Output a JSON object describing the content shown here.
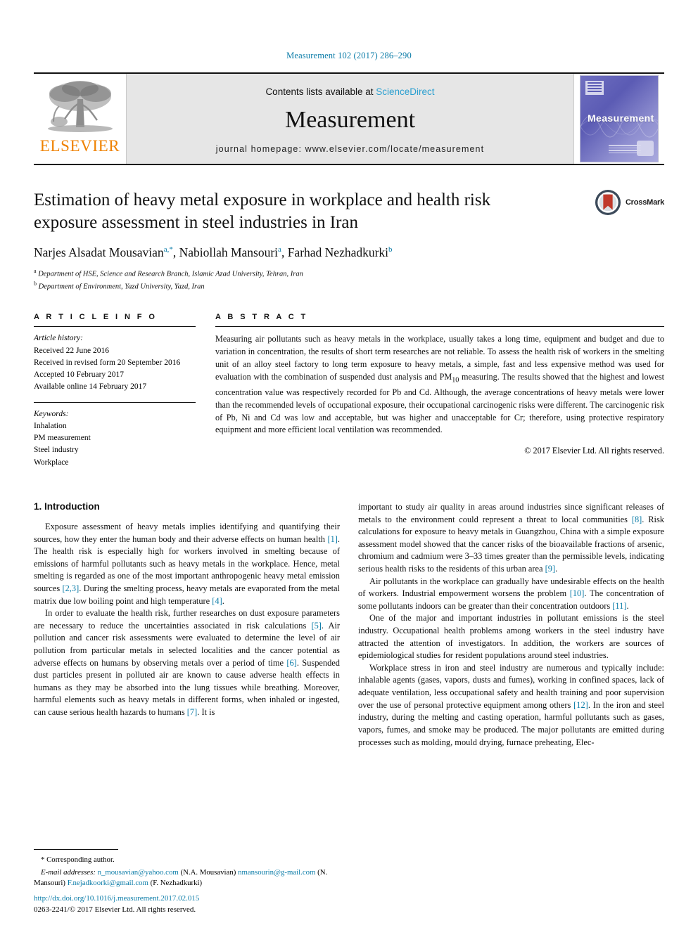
{
  "running_head": "Measurement 102 (2017) 286–290",
  "masthead": {
    "publisher_wordmark": "ELSEVIER",
    "contents_prefix": "Contents lists available at ",
    "contents_link": "ScienceDirect",
    "journal_name": "Measurement",
    "homepage": "journal homepage: www.elsevier.com/locate/measurement",
    "cover_title": "Measurement"
  },
  "article": {
    "title": "Estimation of heavy metal exposure in workplace and health risk exposure assessment in steel industries in Iran",
    "authors": [
      {
        "name": "Narjes Alsadat Mousavian",
        "marks": "a,*"
      },
      {
        "name": "Nabiollah Mansouri",
        "marks": "a"
      },
      {
        "name": "Farhad Nezhadkurki",
        "marks": "b"
      }
    ],
    "affiliations": [
      {
        "mark": "a",
        "text": "Department of HSE, Science and Research Branch, Islamic Azad University, Tehran, Iran"
      },
      {
        "mark": "b",
        "text": "Department of Environment, Yazd University, Yazd, Iran"
      }
    ],
    "crossmark_label": "CrossMark"
  },
  "article_info": {
    "heading": "A R T I C L E   I N F O",
    "history_label": "Article history:",
    "history": [
      "Received 22 June 2016",
      "Received in revised form 20 September 2016",
      "Accepted 10 February 2017",
      "Available online 14 February 2017"
    ],
    "keywords_label": "Keywords:",
    "keywords": [
      "Inhalation",
      "PM measurement",
      "Steel industry",
      "Workplace"
    ]
  },
  "abstract": {
    "heading": "A B S T R A C T",
    "text": "Measuring air pollutants such as heavy metals in the workplace, usually takes a long time, equipment and budget and due to variation in concentration, the results of short term researches are not reliable. To assess the health risk of workers in the smelting unit of an alloy steel factory to long term exposure to heavy metals, a simple, fast and less expensive method was used for evaluation with the combination of suspended dust analysis and PM10 measuring. The results showed that the highest and lowest concentration value was respectively recorded for Pb and Cd. Although, the average concentrations of heavy metals were lower than the recommended levels of occupational exposure, their occupational carcinogenic risks were different. The carcinogenic risk of Pb, Ni and Cd was low and acceptable, but was higher and unacceptable for Cr; therefore, using protective respiratory equipment and more efficient local ventilation was recommended.",
    "copyright": "© 2017 Elsevier Ltd. All rights reserved."
  },
  "body": {
    "section_heading": "1. Introduction",
    "left_paragraphs": [
      "Exposure assessment of heavy metals implies identifying and quantifying their sources, how they enter the human body and their adverse effects on human health [1]. The health risk is especially high for workers involved in smelting because of emissions of harmful pollutants such as heavy metals in the workplace. Hence, metal smelting is regarded as one of the most important anthropogenic heavy metal emission sources [2,3]. During the smelting process, heavy metals are evaporated from the metal matrix due low boiling point and high temperature [4].",
      "In order to evaluate the health risk, further researches on dust exposure parameters are necessary to reduce the uncertainties associated in risk calculations [5]. Air pollution and cancer risk assessments were evaluated to determine the level of air pollution from particular metals in selected localities and the cancer potential as adverse effects on humans by observing metals over a period of time [6]. Suspended dust particles present in polluted air are known to cause adverse health effects in humans as they may be absorbed into the lung tissues while breathing. Moreover, harmful elements such as heavy metals in different forms, when inhaled or ingested, can cause serious health hazards to humans [7]. It is"
    ],
    "right_paragraphs": [
      "important to study air quality in areas around industries since significant releases of metals to the environment could represent a threat to local communities [8]. Risk calculations for exposure to heavy metals in Guangzhou, China with a simple exposure assessment model showed that the cancer risks of the bioavailable fractions of arsenic, chromium and cadmium were 3–33 times greater than the permissible levels, indicating serious health risks to the residents of this urban area [9].",
      "Air pollutants in the workplace can gradually have undesirable effects on the health of workers. Industrial empowerment worsens the problem [10]. The concentration of some pollutants indoors can be greater than their concentration outdoors [11].",
      "One of the major and important industries in pollutant emissions is the steel industry. Occupational health problems among workers in the steel industry have attracted the attention of investigators. In addition, the workers are sources of epidemiological studies for resident populations around steel industries.",
      "Workplace stress in iron and steel industry are numerous and typically include: inhalable agents (gases, vapors, dusts and fumes), working in confined spaces, lack of adequate ventilation, less occupational safety and health training and poor supervision over the use of personal protective equipment among others [12]. In the iron and steel industry, during the melting and casting operation, harmful pollutants such as gases, vapors, fumes, and smoke may be produced. The major pollutants are emitted during processes such as molding, mould drying, furnace preheating, Elec-"
    ]
  },
  "footnote": {
    "corresponding": "* Corresponding author.",
    "emails_label": "E-mail addresses:",
    "emails": [
      {
        "address": "n_mousavian@yahoo.com",
        "owner": "(N.A. Mousavian)"
      },
      {
        "address": "nmansourin@g-mail.com",
        "owner": "(N. Mansouri)"
      },
      {
        "address": "F.nejadkoorki@gmail.com",
        "owner": "(F. Nezhadkurki)"
      }
    ]
  },
  "doc_footer": {
    "doi": "http://dx.doi.org/10.1016/j.measurement.2017.02.015",
    "issn_line": "0263-2241/© 2017 Elsevier Ltd. All rights reserved."
  },
  "colors": {
    "link": "#0b7ca8",
    "elsevier_orange": "#ef8200",
    "sciencedirect": "#2a9fd0",
    "cover": "#5b5bb4",
    "crossmark_red": "#c0392b"
  }
}
